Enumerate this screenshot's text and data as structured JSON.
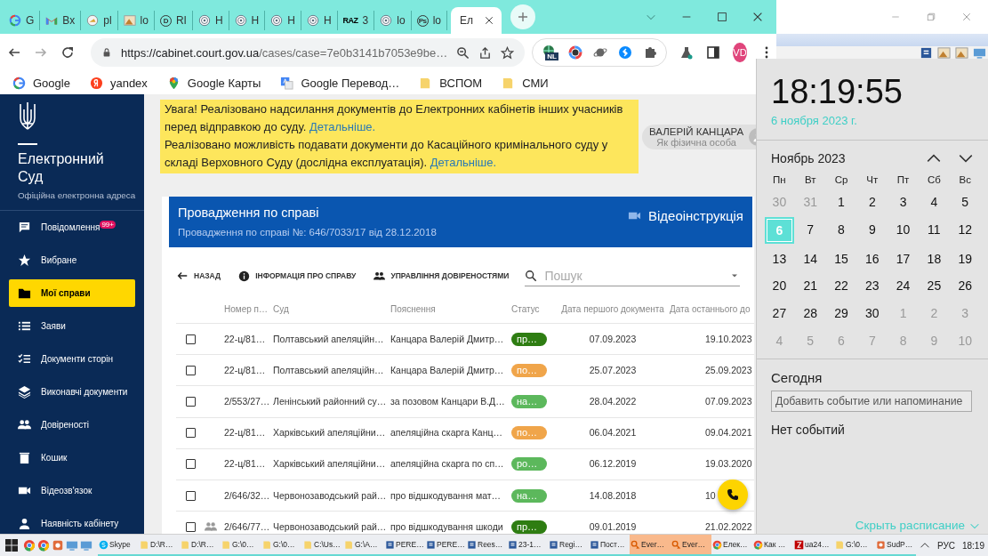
{
  "browser": {
    "tabs": [
      {
        "kind": "google",
        "title": "G",
        "selected": false
      },
      {
        "kind": "gmail",
        "title": "Вх",
        "selected": false
      },
      {
        "kind": "round",
        "title": "pl",
        "selected": false
      },
      {
        "kind": "picture",
        "title": "lo",
        "selected": false
      },
      {
        "kind": "letter",
        "badge": "D",
        "title": "RI",
        "selected": false
      },
      {
        "kind": "seal",
        "title": "Н",
        "selected": false
      },
      {
        "kind": "seal",
        "title": "Н",
        "selected": false
      },
      {
        "kind": "seal",
        "title": "Н",
        "selected": false
      },
      {
        "kind": "seal",
        "title": "Н",
        "selected": false
      },
      {
        "kind": "square",
        "badge": "RAZ",
        "title": "3",
        "selected": false
      },
      {
        "kind": "seal",
        "title": "lo",
        "selected": false
      },
      {
        "kind": "letter",
        "badge": "Ps",
        "title": "lo",
        "selected": false
      },
      {
        "kind": "none",
        "title": "Ел",
        "selected": true
      }
    ],
    "url_host": "https://cabinet.court.gov.ua",
    "url_path": "/cases/case=7e0b3141b7053e9be…",
    "extension_badge": "NL",
    "avatar": "VD",
    "bookmarks": [
      {
        "kind": "google",
        "label": "Google"
      },
      {
        "kind": "yandex",
        "label": "yandex"
      },
      {
        "kind": "maps",
        "label": "Google Карты"
      },
      {
        "kind": "translate",
        "label": "Google Перевод…"
      },
      {
        "kind": "folder",
        "label": "ВСПОМ"
      },
      {
        "kind": "folder",
        "label": "СМИ"
      }
    ]
  },
  "sidebar": {
    "title": "Електронний Суд",
    "subtitle": "Офіційна електронна адреса",
    "items": [
      {
        "kind": "chat",
        "label": "Повідомлення",
        "badge": "99+",
        "selected": false
      },
      {
        "kind": "star",
        "label": "Вибране",
        "selected": false
      },
      {
        "kind": "folder",
        "label": "Мої справи",
        "selected": true
      },
      {
        "kind": "list",
        "label": "Заяви",
        "selected": false
      },
      {
        "kind": "checklist",
        "label": "Документи сторін",
        "selected": false
      },
      {
        "kind": "layers",
        "label": "Виконавчі документи",
        "selected": false
      },
      {
        "kind": "people",
        "label": "Довіреності",
        "selected": false
      },
      {
        "kind": "trash",
        "label": "Кошик",
        "selected": false
      },
      {
        "kind": "video",
        "label": "Відеозв'язок",
        "selected": false
      },
      {
        "kind": "person",
        "label": "Наявність кабінету",
        "selected": false
      }
    ]
  },
  "notices": [
    {
      "text": "Увага! Реалізовано надсилання документів до Електронних кабінетів інших учасників перед відправкою до суду.",
      "link": "Детальніше."
    },
    {
      "text": "Реалізовано можливість подавати документи до Касаційного кримінального суду у складі Верховного Суду (дослідна експлуатація).",
      "link": "Детальніше."
    }
  ],
  "user": {
    "name": "ВАЛЕРІЙ КАНЦАРА",
    "role": "Як фізична особа"
  },
  "case": {
    "title": "Провадження по справі",
    "subtitle": "Провадження по справі №: 646/7033/17 від 28.12.2018",
    "video_link": "Відеоінструкція",
    "actions": [
      {
        "kind": "back",
        "label": "НАЗАД"
      },
      {
        "kind": "info",
        "label": "ІНФОРМАЦІЯ ПРО СПРАВУ"
      },
      {
        "kind": "people",
        "label": "УПРАВЛІННЯ ДОВІРЕНОСТЯМИ"
      }
    ],
    "search": {
      "placeholder": "Пошук"
    },
    "columns": [
      "Номер п…",
      "Суд",
      "Пояснення",
      "Статус",
      "Дата першого документа",
      "Дата останнього до"
    ],
    "rows": [
      {
        "checked": false,
        "shared": false,
        "number": "22-ц/81…",
        "court": "Полтавський апеляційн…",
        "note": "Канцара Валерій Дмитр…",
        "status": "пр…",
        "color": "#2e7d12",
        "first_date": "07.09.2023",
        "last_date": "19.10.2023"
      },
      {
        "checked": false,
        "shared": false,
        "number": "22-ц/81…",
        "court": "Полтавський апеляційн…",
        "note": "Канцара Валерій Дмитр…",
        "status": "по…",
        "color": "#f0a54a",
        "first_date": "25.07.2023",
        "last_date": "25.09.2023"
      },
      {
        "checked": false,
        "shared": false,
        "number": "2/553/27…",
        "court": "Ленінський районний су…",
        "note": "за позовом Канцари В.Д…",
        "status": "на…",
        "color": "#5cb85c",
        "first_date": "28.04.2022",
        "last_date": "07.09.2023"
      },
      {
        "checked": false,
        "shared": false,
        "number": "22-ц/81…",
        "court": "Харківський апеляційни…",
        "note": "апеляційна скарга Канц…",
        "status": "по…",
        "color": "#f0a54a",
        "first_date": "06.04.2021",
        "last_date": "09.04.2021"
      },
      {
        "checked": false,
        "shared": false,
        "number": "22-ц/81…",
        "court": "Харківський апеляційни…",
        "note": "апеляційна скарга по сп…",
        "status": "ро…",
        "color": "#5cb85c",
        "first_date": "06.12.2019",
        "last_date": "19.03.2020"
      },
      {
        "checked": false,
        "shared": false,
        "number": "2/646/32…",
        "court": "Червонозаводський рай…",
        "note": "про відшкодування мат…",
        "status": "на…",
        "color": "#5cb85c",
        "first_date": "14.08.2018",
        "last_date": "10"
      },
      {
        "checked": false,
        "shared": true,
        "number": "2/646/77…",
        "court": "Червонозаводський рай…",
        "note": "про відшкодування шкоди",
        "status": "пр…",
        "color": "#2e7d12",
        "first_date": "09.01.2019",
        "last_date": "21.02.2022"
      }
    ]
  },
  "calendar": {
    "time": "18:19:55",
    "date": "6 ноября 2023 г.",
    "month": "Ноябрь 2023",
    "weekdays": [
      "Пн",
      "Вт",
      "Ср",
      "Чт",
      "Пт",
      "Сб",
      "Вс"
    ],
    "days": [
      {
        "day": "30",
        "in_month": false,
        "selected": false
      },
      {
        "day": "31",
        "in_month": false,
        "selected": false
      },
      {
        "day": "1",
        "in_month": true,
        "selected": false
      },
      {
        "day": "2",
        "in_month": true,
        "selected": false
      },
      {
        "day": "3",
        "in_month": true,
        "selected": false
      },
      {
        "day": "4",
        "in_month": true,
        "selected": false
      },
      {
        "day": "5",
        "in_month": true,
        "selected": false
      },
      {
        "day": "6",
        "in_month": true,
        "selected": true
      },
      {
        "day": "7",
        "in_month": true,
        "selected": false
      },
      {
        "day": "8",
        "in_month": true,
        "selected": false
      },
      {
        "day": "9",
        "in_month": true,
        "selected": false
      },
      {
        "day": "10",
        "in_month": true,
        "selected": false
      },
      {
        "day": "11",
        "in_month": true,
        "selected": false
      },
      {
        "day": "12",
        "in_month": true,
        "selected": false
      },
      {
        "day": "13",
        "in_month": true,
        "selected": false
      },
      {
        "day": "14",
        "in_month": true,
        "selected": false
      },
      {
        "day": "15",
        "in_month": true,
        "selected": false
      },
      {
        "day": "16",
        "in_month": true,
        "selected": false
      },
      {
        "day": "17",
        "in_month": true,
        "selected": false
      },
      {
        "day": "18",
        "in_month": true,
        "selected": false
      },
      {
        "day": "19",
        "in_month": true,
        "selected": false
      },
      {
        "day": "20",
        "in_month": true,
        "selected": false
      },
      {
        "day": "21",
        "in_month": true,
        "selected": false
      },
      {
        "day": "22",
        "in_month": true,
        "selected": false
      },
      {
        "day": "23",
        "in_month": true,
        "selected": false
      },
      {
        "day": "24",
        "in_month": true,
        "selected": false
      },
      {
        "day": "25",
        "in_month": true,
        "selected": false
      },
      {
        "day": "26",
        "in_month": true,
        "selected": false
      },
      {
        "day": "27",
        "in_month": true,
        "selected": false
      },
      {
        "day": "28",
        "in_month": true,
        "selected": false
      },
      {
        "day": "29",
        "in_month": true,
        "selected": false
      },
      {
        "day": "30",
        "in_month": true,
        "selected": false
      },
      {
        "day": "1",
        "in_month": false,
        "selected": false
      },
      {
        "day": "2",
        "in_month": false,
        "selected": false
      },
      {
        "day": "3",
        "in_month": false,
        "selected": false
      },
      {
        "day": "4",
        "in_month": false,
        "selected": false
      },
      {
        "day": "5",
        "in_month": false,
        "selected": false
      },
      {
        "day": "6",
        "in_month": false,
        "selected": false
      },
      {
        "day": "7",
        "in_month": false,
        "selected": false
      },
      {
        "day": "8",
        "in_month": false,
        "selected": false
      },
      {
        "day": "9",
        "in_month": false,
        "selected": false
      },
      {
        "day": "10",
        "in_month": false,
        "selected": false
      }
    ],
    "today": "Сегодня",
    "event_field": {
      "placeholder": "Добавить событие или напоминание"
    },
    "no_events": "Нет событий",
    "hide_link": "Скрыть расписание"
  },
  "taskbar": {
    "pinned": [
      {
        "kind": "chrome"
      },
      {
        "kind": "chrome"
      },
      {
        "kind": "app"
      },
      {
        "kind": "screen"
      },
      {
        "kind": "screen"
      }
    ],
    "apps": [
      {
        "kind": "skype",
        "label": "Skype",
        "active": false
      },
      {
        "kind": "folder",
        "label": "D:\\R…",
        "active": false
      },
      {
        "kind": "folder",
        "label": "D:\\R…",
        "active": false
      },
      {
        "kind": "folder",
        "label": "G:\\0…",
        "active": false
      },
      {
        "kind": "folder",
        "label": "G:\\0…",
        "active": false
      },
      {
        "kind": "folder",
        "label": "C:\\Us…",
        "active": false
      },
      {
        "kind": "folder",
        "label": "G:\\A…",
        "active": false
      },
      {
        "kind": "doc",
        "label": "PERE…",
        "active": false
      },
      {
        "kind": "doc",
        "label": "PERE…",
        "active": false
      },
      {
        "kind": "doc",
        "label": "Rees…",
        "active": false
      },
      {
        "kind": "doc",
        "label": "23-1…",
        "active": false
      },
      {
        "kind": "doc",
        "label": "Regi…",
        "active": false
      },
      {
        "kind": "doc",
        "label": "Пост…",
        "active": false
      },
      {
        "kind": "key",
        "label": "Ever…",
        "active": true
      },
      {
        "kind": "key",
        "label": "Ever…",
        "active": true
      },
      {
        "kind": "chrome",
        "label": "Елек…",
        "active": false
      },
      {
        "kind": "chrome",
        "label": "Как …",
        "active": false
      },
      {
        "kind": "filezilla",
        "label": "ua24…",
        "active": false
      },
      {
        "kind": "folder",
        "label": "G:\\0…",
        "active": false
      },
      {
        "kind": "app",
        "label": "SudP…",
        "active": false
      }
    ],
    "language": "РУС",
    "clock": "18:19"
  }
}
